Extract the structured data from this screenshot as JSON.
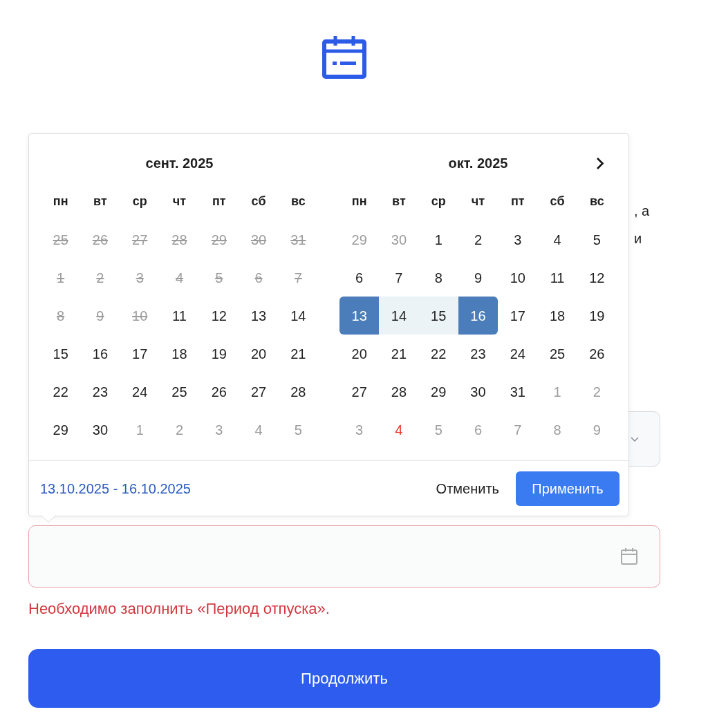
{
  "behind_popup": {
    "text_lines": [
      ", а",
      "и"
    ]
  },
  "calendar": {
    "months": [
      {
        "title": "сент. 2025",
        "weekdays": [
          "пн",
          "вт",
          "ср",
          "чт",
          "пт",
          "сб",
          "вс"
        ],
        "weeks": [
          [
            {
              "label": "25",
              "kind": "past",
              "selected": false,
              "in_range": false
            },
            {
              "label": "26",
              "kind": "past",
              "selected": false,
              "in_range": false
            },
            {
              "label": "27",
              "kind": "past",
              "selected": false,
              "in_range": false
            },
            {
              "label": "28",
              "kind": "past",
              "selected": false,
              "in_range": false
            },
            {
              "label": "29",
              "kind": "past",
              "selected": false,
              "in_range": false
            },
            {
              "label": "30",
              "kind": "past",
              "selected": false,
              "in_range": false
            },
            {
              "label": "31",
              "kind": "past",
              "selected": false,
              "in_range": false
            }
          ],
          [
            {
              "label": "1",
              "kind": "past",
              "selected": false,
              "in_range": false
            },
            {
              "label": "2",
              "kind": "past",
              "selected": false,
              "in_range": false
            },
            {
              "label": "3",
              "kind": "past",
              "selected": false,
              "in_range": false
            },
            {
              "label": "4",
              "kind": "past",
              "selected": false,
              "in_range": false
            },
            {
              "label": "5",
              "kind": "past",
              "selected": false,
              "in_range": false
            },
            {
              "label": "6",
              "kind": "past",
              "selected": false,
              "in_range": false
            },
            {
              "label": "7",
              "kind": "past",
              "selected": false,
              "in_range": false
            }
          ],
          [
            {
              "label": "8",
              "kind": "past",
              "selected": false,
              "in_range": false
            },
            {
              "label": "9",
              "kind": "past",
              "selected": false,
              "in_range": false
            },
            {
              "label": "10",
              "kind": "past",
              "selected": false,
              "in_range": false
            },
            {
              "label": "11",
              "kind": "day",
              "selected": false,
              "in_range": false
            },
            {
              "label": "12",
              "kind": "day",
              "selected": false,
              "in_range": false
            },
            {
              "label": "13",
              "kind": "day",
              "selected": false,
              "in_range": false
            },
            {
              "label": "14",
              "kind": "day",
              "selected": false,
              "in_range": false
            }
          ],
          [
            {
              "label": "15",
              "kind": "day",
              "selected": false,
              "in_range": false
            },
            {
              "label": "16",
              "kind": "day",
              "selected": false,
              "in_range": false
            },
            {
              "label": "17",
              "kind": "day",
              "selected": false,
              "in_range": false
            },
            {
              "label": "18",
              "kind": "day",
              "selected": false,
              "in_range": false
            },
            {
              "label": "19",
              "kind": "day",
              "selected": false,
              "in_range": false
            },
            {
              "label": "20",
              "kind": "day",
              "selected": false,
              "in_range": false
            },
            {
              "label": "21",
              "kind": "day",
              "selected": false,
              "in_range": false
            }
          ],
          [
            {
              "label": "22",
              "kind": "day",
              "selected": false,
              "in_range": false
            },
            {
              "label": "23",
              "kind": "day",
              "selected": false,
              "in_range": false
            },
            {
              "label": "24",
              "kind": "day",
              "selected": false,
              "in_range": false
            },
            {
              "label": "25",
              "kind": "day",
              "selected": false,
              "in_range": false
            },
            {
              "label": "26",
              "kind": "day",
              "selected": false,
              "in_range": false
            },
            {
              "label": "27",
              "kind": "day",
              "selected": false,
              "in_range": false
            },
            {
              "label": "28",
              "kind": "day",
              "selected": false,
              "in_range": false
            }
          ],
          [
            {
              "label": "29",
              "kind": "day",
              "selected": false,
              "in_range": false
            },
            {
              "label": "30",
              "kind": "day",
              "selected": false,
              "in_range": false
            },
            {
              "label": "1",
              "kind": "outside",
              "selected": false,
              "in_range": false
            },
            {
              "label": "2",
              "kind": "outside",
              "selected": false,
              "in_range": false
            },
            {
              "label": "3",
              "kind": "outside",
              "selected": false,
              "in_range": false
            },
            {
              "label": "4",
              "kind": "outside",
              "selected": false,
              "in_range": false
            },
            {
              "label": "5",
              "kind": "outside",
              "selected": false,
              "in_range": false
            }
          ]
        ]
      },
      {
        "title": "окт. 2025",
        "weekdays": [
          "пн",
          "вт",
          "ср",
          "чт",
          "пт",
          "сб",
          "вс"
        ],
        "weeks": [
          [
            {
              "label": "29",
              "kind": "outside",
              "selected": false,
              "in_range": false
            },
            {
              "label": "30",
              "kind": "outside",
              "selected": false,
              "in_range": false
            },
            {
              "label": "1",
              "kind": "day",
              "selected": false,
              "in_range": false
            },
            {
              "label": "2",
              "kind": "day",
              "selected": false,
              "in_range": false
            },
            {
              "label": "3",
              "kind": "day",
              "selected": false,
              "in_range": false
            },
            {
              "label": "4",
              "kind": "day",
              "selected": false,
              "in_range": false
            },
            {
              "label": "5",
              "kind": "day",
              "selected": false,
              "in_range": false
            }
          ],
          [
            {
              "label": "6",
              "kind": "day",
              "selected": false,
              "in_range": false
            },
            {
              "label": "7",
              "kind": "day",
              "selected": false,
              "in_range": false
            },
            {
              "label": "8",
              "kind": "day",
              "selected": false,
              "in_range": false
            },
            {
              "label": "9",
              "kind": "day",
              "selected": false,
              "in_range": false
            },
            {
              "label": "10",
              "kind": "day",
              "selected": false,
              "in_range": false
            },
            {
              "label": "11",
              "kind": "day",
              "selected": false,
              "in_range": false
            },
            {
              "label": "12",
              "kind": "day",
              "selected": false,
              "in_range": false
            }
          ],
          [
            {
              "label": "13",
              "kind": "day",
              "selected": true,
              "in_range": false
            },
            {
              "label": "14",
              "kind": "day",
              "selected": false,
              "in_range": true
            },
            {
              "label": "15",
              "kind": "day",
              "selected": false,
              "in_range": true
            },
            {
              "label": "16",
              "kind": "day",
              "selected": true,
              "in_range": false
            },
            {
              "label": "17",
              "kind": "day",
              "selected": false,
              "in_range": false
            },
            {
              "label": "18",
              "kind": "day",
              "selected": false,
              "in_range": false
            },
            {
              "label": "19",
              "kind": "day",
              "selected": false,
              "in_range": false
            }
          ],
          [
            {
              "label": "20",
              "kind": "day",
              "selected": false,
              "in_range": false
            },
            {
              "label": "21",
              "kind": "day",
              "selected": false,
              "in_range": false
            },
            {
              "label": "22",
              "kind": "day",
              "selected": false,
              "in_range": false
            },
            {
              "label": "23",
              "kind": "day",
              "selected": false,
              "in_range": false
            },
            {
              "label": "24",
              "kind": "day",
              "selected": false,
              "in_range": false
            },
            {
              "label": "25",
              "kind": "day",
              "selected": false,
              "in_range": false
            },
            {
              "label": "26",
              "kind": "day",
              "selected": false,
              "in_range": false
            }
          ],
          [
            {
              "label": "27",
              "kind": "day",
              "selected": false,
              "in_range": false
            },
            {
              "label": "28",
              "kind": "day",
              "selected": false,
              "in_range": false
            },
            {
              "label": "29",
              "kind": "day",
              "selected": false,
              "in_range": false
            },
            {
              "label": "30",
              "kind": "day",
              "selected": false,
              "in_range": false
            },
            {
              "label": "31",
              "kind": "day",
              "selected": false,
              "in_range": false
            },
            {
              "label": "1",
              "kind": "outside",
              "selected": false,
              "in_range": false
            },
            {
              "label": "2",
              "kind": "outside",
              "selected": false,
              "in_range": false
            }
          ],
          [
            {
              "label": "3",
              "kind": "outside",
              "selected": false,
              "in_range": false
            },
            {
              "label": "4",
              "kind": "holiday",
              "selected": false,
              "in_range": false
            },
            {
              "label": "5",
              "kind": "outside",
              "selected": false,
              "in_range": false
            },
            {
              "label": "6",
              "kind": "outside",
              "selected": false,
              "in_range": false
            },
            {
              "label": "7",
              "kind": "outside",
              "selected": false,
              "in_range": false
            },
            {
              "label": "8",
              "kind": "outside",
              "selected": false,
              "in_range": false
            },
            {
              "label": "9",
              "kind": "outside",
              "selected": false,
              "in_range": false
            }
          ]
        ]
      }
    ],
    "footer": {
      "range": "13.10.2025 - 16.10.2025",
      "cancel": "Отменить",
      "apply": "Применить"
    }
  },
  "period_field": {
    "invalid": true,
    "error": "Необходимо заполнить «Период отпуска»."
  },
  "continue_button": "Продолжить"
}
